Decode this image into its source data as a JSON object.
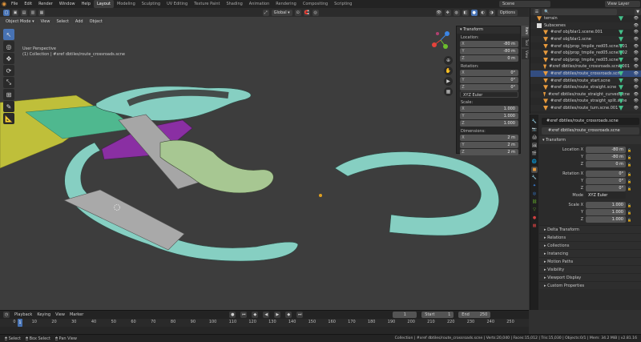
{
  "topbar": {
    "menus": [
      "File",
      "Edit",
      "Render",
      "Window",
      "Help"
    ],
    "workspaces": [
      "Layout",
      "Modeling",
      "Sculpting",
      "UV Editing",
      "Texture Paint",
      "Shading",
      "Animation",
      "Rendering",
      "Compositing",
      "Scripting"
    ],
    "active_workspace": "Layout",
    "scene": "Scene",
    "view_layer": "View Layer"
  },
  "viewport_header": {
    "mode": "Object Mode",
    "menus": [
      "View",
      "Select",
      "Add",
      "Object"
    ],
    "orientation": "Global",
    "options": "Options"
  },
  "viewport": {
    "perspective": "User Perspective",
    "collection": "(1) Collection | #xref dbtiles/route_crossroads.scne"
  },
  "npanel": {
    "title": "Transform",
    "location_label": "Location:",
    "location": [
      {
        "axis": "X",
        "value": "-80 m"
      },
      {
        "axis": "Y",
        "value": "-80 m"
      },
      {
        "axis": "Z",
        "value": "0 m"
      }
    ],
    "rotation_label": "Rotation:",
    "rotation": [
      {
        "axis": "X",
        "value": "0°"
      },
      {
        "axis": "Y",
        "value": "0°"
      },
      {
        "axis": "Z",
        "value": "0°"
      }
    ],
    "rotation_mode": "XYZ Euler",
    "scale_label": "Scale:",
    "scale": [
      {
        "axis": "X",
        "value": "1.000"
      },
      {
        "axis": "Y",
        "value": "1.000"
      },
      {
        "axis": "Z",
        "value": "1.000"
      }
    ],
    "dimensions_label": "Dimensions:",
    "dimensions": [
      {
        "axis": "X",
        "value": "2 m"
      },
      {
        "axis": "Y",
        "value": "2 m"
      },
      {
        "axis": "Z",
        "value": "2 m"
      }
    ],
    "tabs": [
      "Item",
      "Tool",
      "View"
    ]
  },
  "outliner": {
    "items": [
      {
        "label": "terrain",
        "selected": false
      },
      {
        "label": "Subscenes",
        "selected": false
      },
      {
        "label": "#xref obj/blar1.scene.001",
        "selected": false
      },
      {
        "label": "#xref obj/blar1.scne",
        "selected": false
      },
      {
        "label": "#xref obj/prop_tmpile_red05.scne.001",
        "selected": false
      },
      {
        "label": "#xref obj/prop_tmpile_red05.scne.002",
        "selected": false
      },
      {
        "label": "#xref obj/prop_tmpile_red05.scne",
        "selected": false
      },
      {
        "label": "#xref dbtiles/route_crossroads.scne.001",
        "selected": false
      },
      {
        "label": "#xref dbtiles/route_crossroads.scne",
        "selected": true
      },
      {
        "label": "#xref dbtiles/route_start.scne",
        "selected": false
      },
      {
        "label": "#xref dbtiles/route_straight.scne",
        "selected": false
      },
      {
        "label": "#xref dbtiles/route_straight_curved.scne",
        "selected": false
      },
      {
        "label": "#xref dbtiles/route_straight_split.scne",
        "selected": false
      },
      {
        "label": "#xref dbtiles/route_turn.scne.001",
        "selected": false
      }
    ]
  },
  "properties": {
    "object_path": "#xref dbtiles/route_crossroads.scne",
    "object_name": "#xref dbtiles/route_crossroads.scne",
    "transform_title": "Transform",
    "location": [
      {
        "label": "Location X",
        "value": "-80 m"
      },
      {
        "label": "Y",
        "value": "-80 m"
      },
      {
        "label": "Z",
        "value": "0 m"
      }
    ],
    "rotation": [
      {
        "label": "Rotation X",
        "value": "0°"
      },
      {
        "label": "Y",
        "value": "0°"
      },
      {
        "label": "Z",
        "value": "0°"
      }
    ],
    "mode_label": "Mode",
    "mode_value": "XYZ Euler",
    "scale": [
      {
        "label": "Scale X",
        "value": "1.000"
      },
      {
        "label": "Y",
        "value": "1.000"
      },
      {
        "label": "Z",
        "value": "1.000"
      }
    ],
    "delta_transform": "Delta Transform",
    "sections": [
      "Relations",
      "Collections",
      "Instancing",
      "Motion Paths",
      "Visibility",
      "Viewport Display",
      "Custom Properties"
    ]
  },
  "timeline": {
    "menus": [
      "Playback",
      "Keying",
      "View",
      "Marker"
    ],
    "current_frame": "1",
    "start_label": "Start",
    "start": "1",
    "end_label": "End",
    "end": "250",
    "ticks": [
      "0",
      "10",
      "20",
      "30",
      "40",
      "50",
      "60",
      "70",
      "80",
      "90",
      "100",
      "110",
      "120",
      "130",
      "140",
      "150",
      "160",
      "170",
      "180",
      "190",
      "200",
      "210",
      "220",
      "230",
      "240",
      "250"
    ],
    "playhead": "1"
  },
  "statusbar": {
    "left": [
      "Select",
      "Box Select",
      "Pan View"
    ],
    "right": "Collection | #xref dbtiles/route_crossroads.scne | Verts:20,040 | Faces:15,012 | Tris:15,030 | Objects:0/1 | Mem: 34.2 MiB | v2.81.16"
  },
  "colors": {
    "accent": "#4772b3",
    "road_cyan": "#86cfc2",
    "purple": "#8a2fa3",
    "yellow": "#bfbf3a",
    "ground": "#3d3d3d"
  }
}
